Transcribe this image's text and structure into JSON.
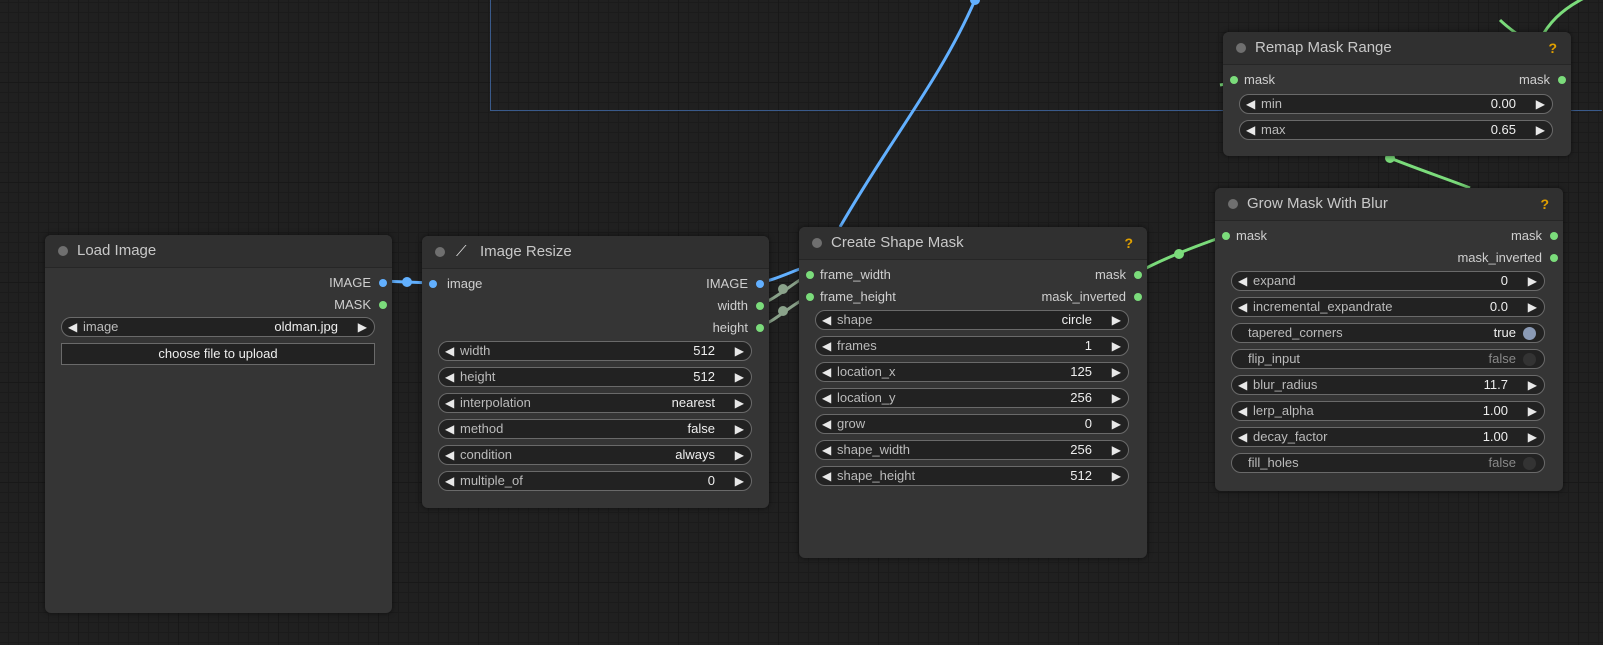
{
  "nodes": {
    "load_image": {
      "title": "Load Image",
      "outputs": [
        "IMAGE",
        "MASK"
      ],
      "image_widget": {
        "label": "image",
        "value": "oldman.jpg"
      },
      "upload_button": "choose file to upload"
    },
    "image_resize": {
      "title": "Image Resize",
      "inputs": [
        "image"
      ],
      "outputs": [
        "IMAGE",
        "width",
        "height"
      ],
      "widgets": [
        {
          "label": "width",
          "value": "512"
        },
        {
          "label": "height",
          "value": "512"
        },
        {
          "label": "interpolation",
          "value": "nearest"
        },
        {
          "label": "method",
          "value": "false"
        },
        {
          "label": "condition",
          "value": "always"
        },
        {
          "label": "multiple_of",
          "value": "0"
        }
      ]
    },
    "create_shape_mask": {
      "title": "Create Shape Mask",
      "help": "?",
      "inputs": [
        "frame_width",
        "frame_height"
      ],
      "outputs": [
        "mask",
        "mask_inverted"
      ],
      "widgets": [
        {
          "label": "shape",
          "value": "circle"
        },
        {
          "label": "frames",
          "value": "1"
        },
        {
          "label": "location_x",
          "value": "125"
        },
        {
          "label": "location_y",
          "value": "256"
        },
        {
          "label": "grow",
          "value": "0"
        },
        {
          "label": "shape_width",
          "value": "256"
        },
        {
          "label": "shape_height",
          "value": "512"
        }
      ]
    },
    "remap_mask_range": {
      "title": "Remap Mask Range",
      "help": "?",
      "inputs": [
        "mask"
      ],
      "outputs": [
        "mask"
      ],
      "widgets": [
        {
          "label": "min",
          "value": "0.00"
        },
        {
          "label": "max",
          "value": "0.65"
        }
      ]
    },
    "grow_mask_with_blur": {
      "title": "Grow Mask With Blur",
      "help": "?",
      "inputs": [
        "mask"
      ],
      "outputs": [
        "mask",
        "mask_inverted"
      ],
      "widgets": [
        {
          "label": "expand",
          "value": "0"
        },
        {
          "label": "incremental_expandrate",
          "value": "0.0"
        },
        {
          "label": "tapered_corners",
          "value": "true"
        },
        {
          "label": "flip_input",
          "value": "false"
        },
        {
          "label": "blur_radius",
          "value": "11.7"
        },
        {
          "label": "lerp_alpha",
          "value": "1.00"
        },
        {
          "label": "decay_factor",
          "value": "1.00"
        },
        {
          "label": "fill_holes",
          "value": "false"
        }
      ]
    }
  },
  "colors": {
    "image_link": "#62b0ff",
    "mask_link": "#7bdc7b",
    "int_link": "#8aa28a",
    "help": "#e0a000"
  }
}
